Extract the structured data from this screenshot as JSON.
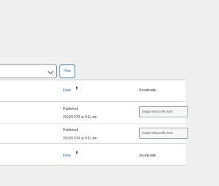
{
  "filters": {
    "filter_label": "Filter"
  },
  "columns": {
    "date": "Date",
    "shortcode": "Shortcode"
  },
  "rows": [
    {
      "status": "Published",
      "datetime": "2022/07/29 at 9:11 am",
      "shortcode": "[wppb-edit-profile form"
    },
    {
      "status": "Published",
      "datetime": "2022/07/29 at 9:11 am",
      "shortcode": "[wppb-edit-profile form"
    }
  ],
  "icons": {
    "select_chevron": "chevron-down-icon",
    "sort_indicator": "sort-arrows-icon"
  },
  "colors": {
    "accent": "#2271b1",
    "background": "#f0f0f1",
    "table": "#ffffff"
  }
}
